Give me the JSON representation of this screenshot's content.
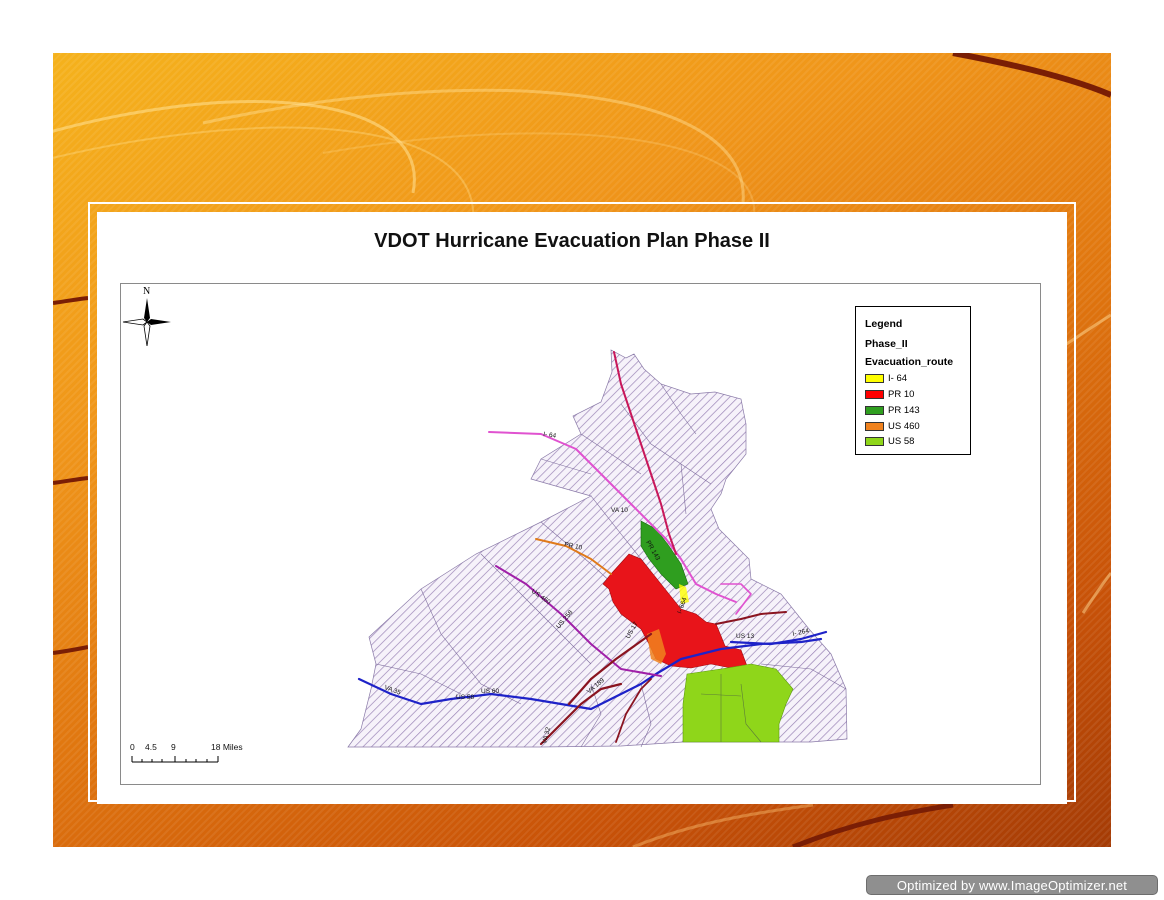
{
  "slide": {
    "title": "VDOT Hurricane Evacuation Plan Phase II"
  },
  "map": {
    "north_label": "N",
    "legend": {
      "heading": "Legend",
      "layer": "Phase_II",
      "field": "Evacuation_route",
      "items": [
        {
          "label": "I- 64",
          "color": "#ffff00"
        },
        {
          "label": "PR 10",
          "color": "#ff0000"
        },
        {
          "label": "PR 143",
          "color": "#2f9e1f"
        },
        {
          "label": "US 460",
          "color": "#f0821e"
        },
        {
          "label": "US 58",
          "color": "#8fd61a"
        }
      ]
    },
    "scale": {
      "ticks": [
        "0",
        "4.5",
        "9",
        "18 Miles"
      ]
    },
    "route_labels": [
      "I- 64",
      "PR 10",
      "PR 143",
      "US 460",
      "US 58",
      "VA 10",
      "US 258",
      "VA 35",
      "VA 189",
      "US 13",
      "US 17",
      "I- 664",
      "I- 264",
      "US 60",
      "VA 32"
    ],
    "colors": {
      "hatch": "#9a84b6",
      "route_blue": "#1e22c8",
      "route_crimson": "#c8175a",
      "route_maroon": "#8a1420",
      "route_purple": "#a020a8",
      "route_pink": "#e052d0",
      "route_orange": "#e07a1a"
    }
  },
  "watermark": {
    "text": "Optimized by www.ImageOptimizer.net"
  }
}
